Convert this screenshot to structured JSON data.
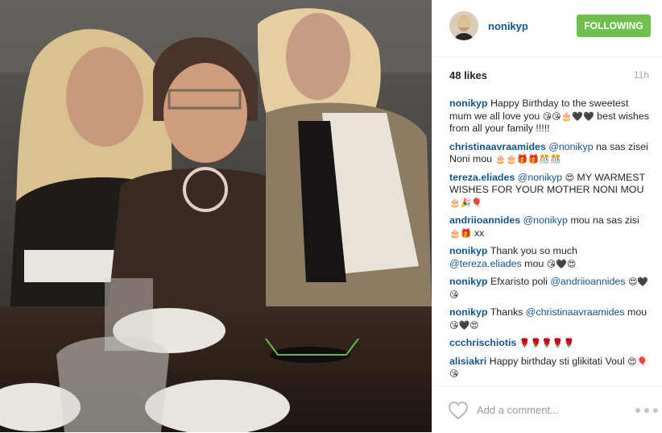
{
  "post": {
    "username": "nonikyp",
    "follow_label": "FOLLOWING",
    "likes": "48 likes",
    "time_ago": "11h",
    "add_comment_placeholder": "Add a comment...",
    "icons": {
      "like": "heart-icon",
      "more": "more-options-icon"
    }
  },
  "comments": [
    {
      "user": "nonikyp",
      "parts": [
        "Happy Birthday to the sweetest mum we all love you ",
        "😘😘🎂🖤🖤",
        " best wishes from all your family !!!!!"
      ]
    },
    {
      "user": "christinaavraamides",
      "mention": "@nonikyp",
      "parts": [
        " na sas zisei Noni mou ",
        "🎂🎂🎁🎁🎊🎊"
      ]
    },
    {
      "user": "tereza.eliades",
      "mention": "@nonikyp",
      "parts": [
        " ",
        "😍",
        " MY WARMEST WISHES FOR YOUR MOTHER NONI MOU ",
        "🎂🎉🎈"
      ]
    },
    {
      "user": "andriioannides",
      "mention": "@nonikyp",
      "parts": [
        " mou na sas zisi ",
        "🎂🎁",
        " xx"
      ]
    },
    {
      "user": "nonikyp",
      "parts": [
        "Thank you so much ",
        "@tereza.eliades",
        " mou ",
        "😘🖤😍"
      ]
    },
    {
      "user": "nonikyp",
      "parts": [
        "Efxaristo poli ",
        "@andriioannides",
        " ",
        "😍🖤😘"
      ]
    },
    {
      "user": "nonikyp",
      "parts": [
        "Thanks ",
        "@christinaavraamides",
        " mou ",
        "😘🖤😍"
      ]
    },
    {
      "user": "ccchrischiotis",
      "parts": [
        " ",
        "🌹🌹🌹🌹🌹"
      ]
    },
    {
      "user": "alisiakri",
      "parts": [
        "Happy birthday sti glikitati Voul ",
        "😍🎈😘"
      ]
    }
  ]
}
